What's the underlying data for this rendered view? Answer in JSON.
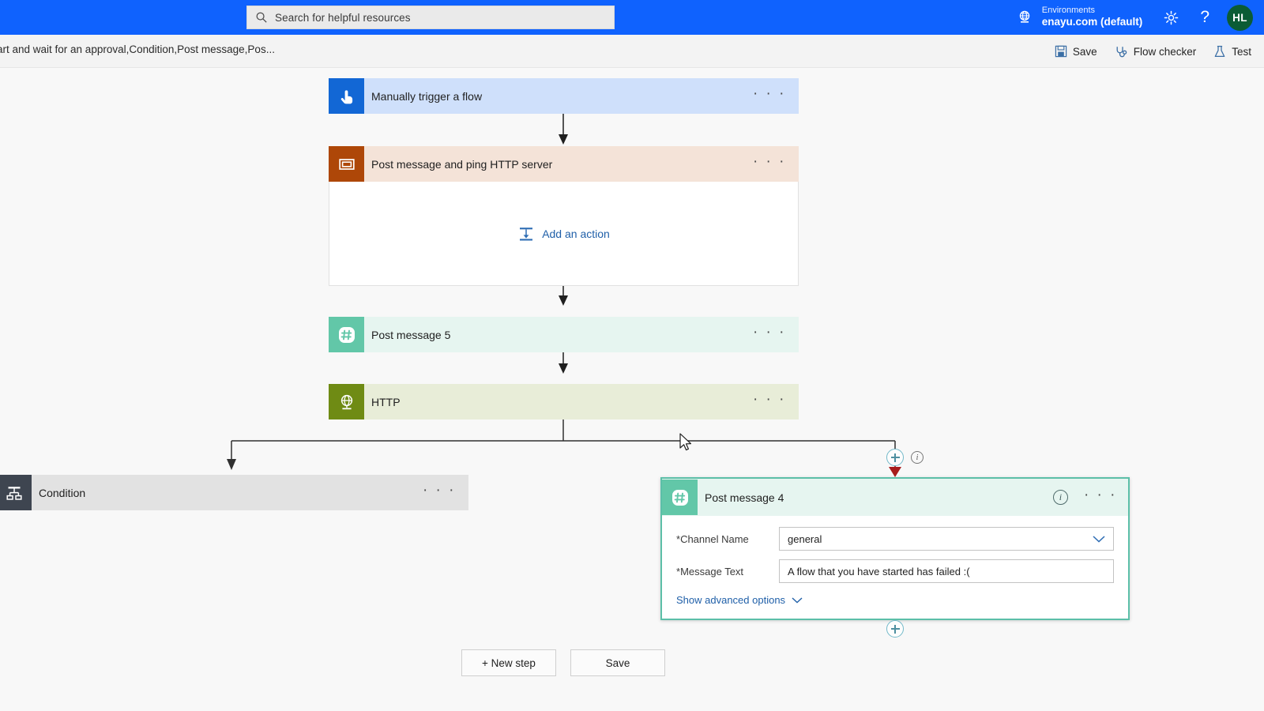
{
  "topbar": {
    "search": {
      "placeholder": "Search for helpful resources",
      "icon": "search-icon"
    },
    "globe_icon": "globe-icon",
    "environment_label": "Environments",
    "environment_value": "enayu.com (default)",
    "gear_icon": "gear-icon",
    "help_icon": "?",
    "avatar_initials": "HL",
    "accent_color": "#0f62fe",
    "avatar_color": "#0b5c35"
  },
  "commandbar": {
    "breadcrumb": "art and wait for an approval,Condition,Post message,Pos...",
    "save_label": "Save",
    "flow_checker_label": "Flow checker",
    "test_label": "Test"
  },
  "canvas": {
    "nodes": {
      "trigger": {
        "title": "Manually trigger a flow",
        "icon": "touch-trigger-icon",
        "icon_color": "#1267d5",
        "header_color": "#cfe0fb",
        "menu": "· · ·"
      },
      "scope": {
        "title": "Post message and ping HTTP server",
        "icon": "scope-icon",
        "icon_color": "#ae4708",
        "header_color": "#f4e3d8",
        "menu": "· · ·",
        "add_action_label": "Add an action",
        "add_action_icon": "add-action-icon"
      },
      "post_message_5": {
        "title": "Post message 5",
        "icon": "slack-icon",
        "icon_color": "#62c7a8",
        "header_color": "#e6f5f0",
        "menu": "· · ·"
      },
      "http": {
        "title": "HTTP",
        "icon": "http-globe-icon",
        "icon_color": "#6f8b14",
        "header_color": "#e8edd8",
        "menu": "· · ·"
      },
      "condition": {
        "title": "Condition",
        "icon": "condition-icon",
        "icon_color": "#3e4550",
        "header_color": "#e2e2e2",
        "menu": "· · ·"
      },
      "post_message_4": {
        "title": "Post message 4",
        "icon": "slack-icon",
        "icon_color": "#62c7a8",
        "header_color": "#e6f5f0",
        "border_color": "#5cbfa8",
        "info_icon": "i",
        "menu": "· · ·",
        "fields": [
          {
            "label": "Channel Name",
            "required_marker": "*",
            "value": "general",
            "control": "dropdown"
          },
          {
            "label": "Message Text",
            "required_marker": "*",
            "value": "A flow that you have started has failed :(",
            "control": "text"
          }
        ],
        "advanced_label": "Show advanced options"
      }
    },
    "branch_info_icon": "i",
    "add_branch_plus": "+",
    "add_below_plus": "+"
  },
  "footer": {
    "new_step_label": "+ New step",
    "save_label": "Save"
  }
}
